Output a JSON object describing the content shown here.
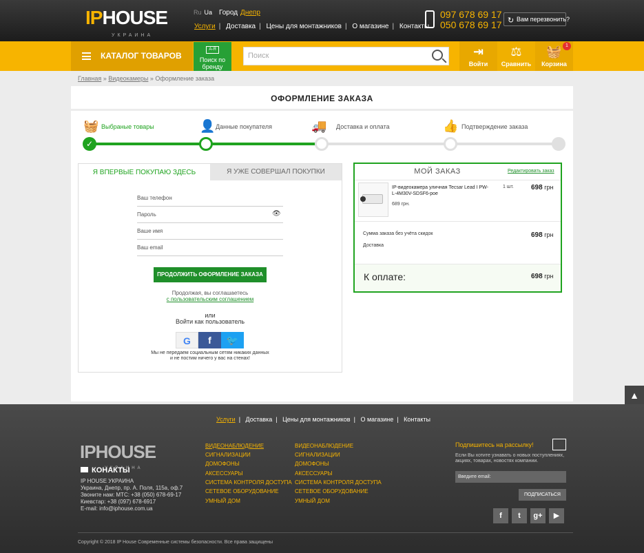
{
  "header": {
    "logo_ip": "IP",
    "logo_house": "HOUSE",
    "logo_sub": "УКРАИНА",
    "lang_ru": "Ru",
    "lang_ua": "Ua",
    "city_label": "Город",
    "city_value": "Днепр",
    "nav": [
      "Услуги",
      "Доставка",
      "Цены для монтажников",
      "О магазине",
      "Контакты"
    ],
    "phone1": "097 678 69 17",
    "phone2": "050 678 69 17",
    "callback_label": "Вам перезвонить?"
  },
  "toolbar": {
    "catalog_label": "КАТАЛОГ ТОВАРОВ",
    "brand_line1": "Поиск по",
    "brand_line2": "бренду",
    "brand_icon_text": "А-Я",
    "search_placeholder": "Поиск",
    "login_label": "Войти",
    "compare_label": "Сравнить",
    "cart_label": "Корзина",
    "cart_count": "1"
  },
  "breadcrumb": [
    "Главная",
    "Видеокамеры",
    "Оформление заказа"
  ],
  "page_title": "ОФОРМЛЕНИЕ ЗАКАЗА",
  "steps": [
    "Выбраные товары",
    "Данные покупателя",
    "Доставка и оплата",
    "Подтверждение заказа"
  ],
  "auth": {
    "tab_new": "Я ВПЕРВЫЕ ПОКУПАЮ ЗДЕСЬ",
    "tab_old": "Я УЖЕ СОВЕРШАЛ ПОКУПКИ",
    "fields": [
      "Ваш телефон",
      "Пароль",
      "Ваше имя",
      "Ваш email"
    ],
    "submit": "ПРОДОЛЖИТЬ ОФОРМЛЕНИЕ ЗАКАЗА",
    "agree1": "Продолжая, вы соглашаетесь",
    "agree2": "с пользовательским соглашением",
    "or": "или",
    "login_as": "Войти как пользователь",
    "privacy1": "Мы не передаем социальным сетям никаких данных",
    "privacy2": "и не постим ничего у вас на стенах!"
  },
  "order": {
    "title": "МОЙ ЗАКАЗ",
    "edit": "Редактировать заказ",
    "product_name": "IP-видеокамера уличная Tecsar Lead I PW-L-4M30V-SDSF6-poe",
    "product_price": "689 грн.",
    "qty": "1 шт.",
    "item_total": "698",
    "currency": "грн",
    "subtotal_label": "Сумма заказа без учёта скидок",
    "subtotal": "698",
    "delivery_label": "Доставка",
    "total_label": "К оплате:",
    "total": "698"
  },
  "footer": {
    "nav": [
      "Услуги",
      "Доставка",
      "Цены для монтажников",
      "О магазине",
      "Контакты"
    ],
    "logo_ip": "IP",
    "logo_house": "HOUSE",
    "logo_sub": "УКРАИНА",
    "contacts_title": "КОНАКТЫ",
    "address": [
      "IP HOUSE УКРАИНА",
      "Украина, Днепр, пр. А. Поля, 115а, оф.7",
      "Звоните нам: МТС: +38 (050) 678-69-17",
      "Киевстар: +38 (097) 678-6917",
      "E-mail: info@iphouse.com.ua"
    ],
    "col1": [
      "ВИДЕОНАБЛЮДЕНИЕ",
      "СИГНАЛИЗАЦИИ",
      "ДОМОФОНЫ",
      "АКСЕССУАРЫ",
      "СИСТЕМА КОНТРОЛЯ ДОСТУПА",
      "СЕТЕВОЕ ОБОРУДОВАНИЕ",
      "УМНЫЙ ДОМ"
    ],
    "col2": [
      "ВИДЕОНАБЛЮДЕНИЕ",
      "СИГНАЛИЗАЦИИ",
      "ДОМОФОНЫ",
      "АКСЕССУАРЫ",
      "СИСТЕМА КОНТРОЛЯ ДОСТУПА",
      "СЕТЕВОЕ ОБОРУДОВАНИЕ",
      "УМНЫЙ ДОМ"
    ],
    "subscribe_title": "Подпишитесь на рассылку!",
    "subscribe_text": "Если Вы хотите узнавать о новых поступлениях, акциях, товарах, новостях компании.",
    "email_placeholder": "Введите email:",
    "subscribe_button": "ПОДПИСАТЬСЯ",
    "copyright": "Copyright © 2018 IP House Современные системы безопасности. Все права защищены"
  },
  "colors": {
    "accent": "#f7b400",
    "green": "#1fa31f",
    "dark": "#2c2c2c"
  }
}
